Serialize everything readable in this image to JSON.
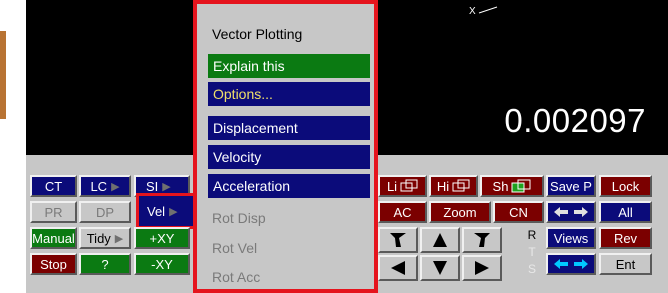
{
  "viewport": {
    "value": "0.002097",
    "axis_label": "X"
  },
  "menu": {
    "title": "Vector Plotting",
    "explain": "Explain this",
    "options": "Options...",
    "displacement": "Displacement",
    "velocity": "Velocity",
    "acceleration": "Acceleration",
    "rot_disp": "Rot Disp",
    "rot_vel": "Rot Vel",
    "rot_acc": "Rot Acc"
  },
  "left_buttons": {
    "ct": "CT",
    "lc": "LC",
    "si": "SI",
    "pr": "PR",
    "dp": "DP",
    "vel": "Vel",
    "manual": "Manual",
    "tidy": "Tidy",
    "plus_xy": "+XY",
    "stop": "Stop",
    "help": "?",
    "minus_xy": "-XY"
  },
  "right_buttons": {
    "li": "Li",
    "hi": "Hi",
    "sh": "Sh",
    "save_p": "Save P",
    "lock": "Lock",
    "ac": "AC",
    "zoom": "Zoom",
    "cn": "CN",
    "all": "All",
    "views": "Views",
    "rev": "Rev",
    "ent": "Ent",
    "rts_r": "R",
    "rts_t": "T",
    "rts_s": "S"
  },
  "colors": {
    "highlight": "#e5141d",
    "navy": "#0b0b7a",
    "maroon": "#7b0000",
    "green": "#0b7a12",
    "arrow_cyan": "#00c8ff"
  }
}
